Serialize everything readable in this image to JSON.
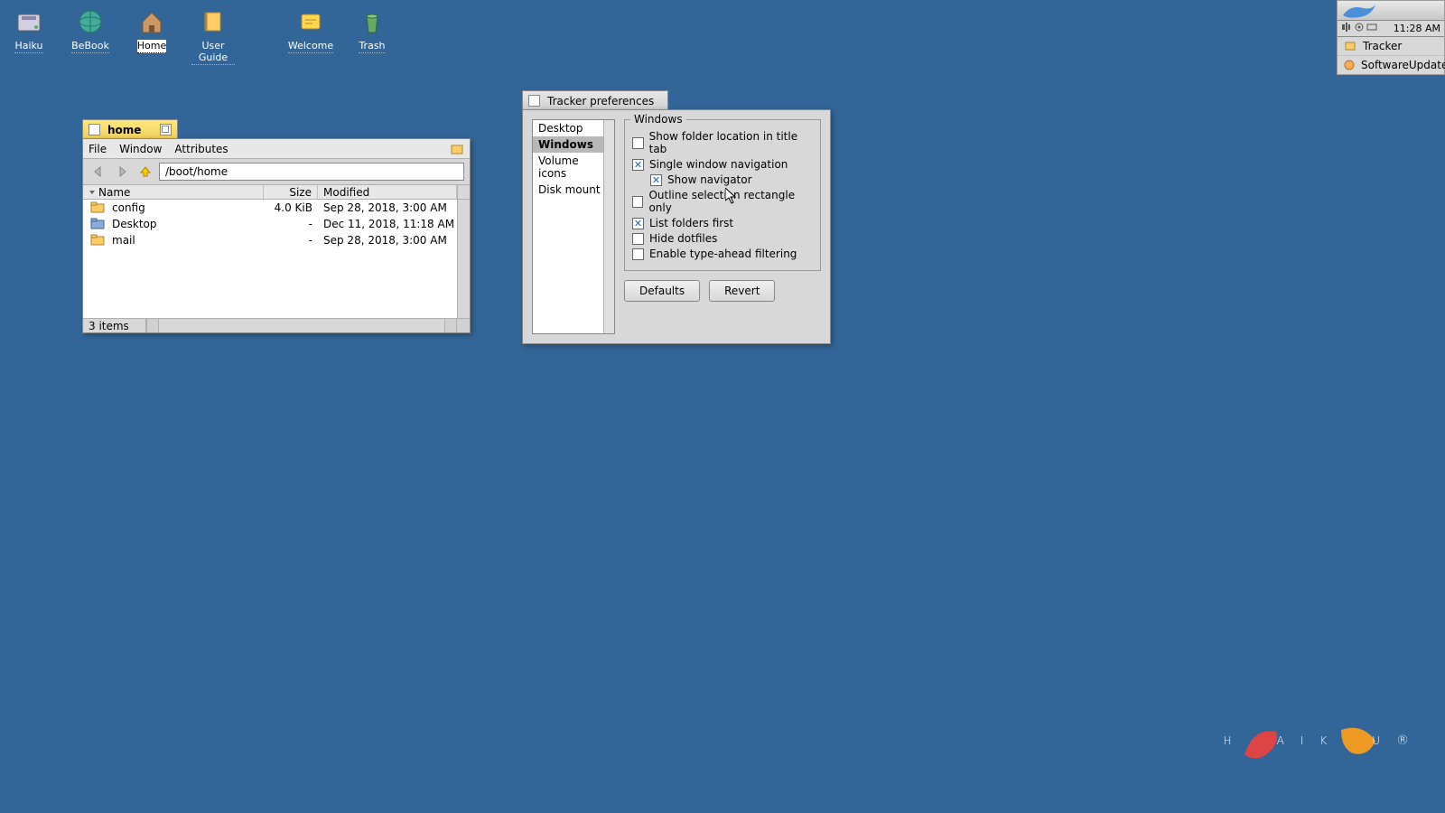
{
  "desktop_icons": [
    {
      "label": "Haiku"
    },
    {
      "label": "BeBook"
    },
    {
      "label": "Home"
    },
    {
      "label": "User Guide"
    },
    {
      "label": "Welcome"
    },
    {
      "label": "Trash"
    }
  ],
  "deskbar": {
    "clock": "11:28 AM",
    "items": [
      {
        "label": "Tracker"
      },
      {
        "label": "SoftwareUpdater"
      }
    ]
  },
  "tracker_home": {
    "title": "home",
    "menu": {
      "file": "File",
      "window": "Window",
      "attributes": "Attributes"
    },
    "path": "/boot/home",
    "columns": {
      "name": "Name",
      "size": "Size",
      "modified": "Modified"
    },
    "rows": [
      {
        "name": "config",
        "size": "4.0 KiB",
        "modified": "Sep 28, 2018, 3:00 AM"
      },
      {
        "name": "Desktop",
        "size": "-",
        "modified": "Dec 11, 2018, 11:18 AM"
      },
      {
        "name": "mail",
        "size": "-",
        "modified": "Sep 28, 2018, 3:00 AM"
      }
    ],
    "status": "3 items"
  },
  "prefs": {
    "title": "Tracker preferences",
    "categories": [
      "Desktop",
      "Windows",
      "Volume icons",
      "Disk mount"
    ],
    "selected_category": "Windows",
    "group_label": "Windows",
    "options": [
      {
        "label": "Show folder location in title tab",
        "checked": false,
        "sub": false
      },
      {
        "label": "Single window navigation",
        "checked": true,
        "sub": false
      },
      {
        "label": "Show navigator",
        "checked": true,
        "sub": true
      },
      {
        "label": "Outline selection rectangle only",
        "checked": false,
        "sub": false
      },
      {
        "label": "List folders first",
        "checked": true,
        "sub": false
      },
      {
        "label": "Hide dotfiles",
        "checked": false,
        "sub": false
      },
      {
        "label": "Enable type-ahead filtering",
        "checked": false,
        "sub": false
      }
    ],
    "buttons": {
      "defaults": "Defaults",
      "revert": "Revert"
    }
  },
  "logo": "HAIKU"
}
